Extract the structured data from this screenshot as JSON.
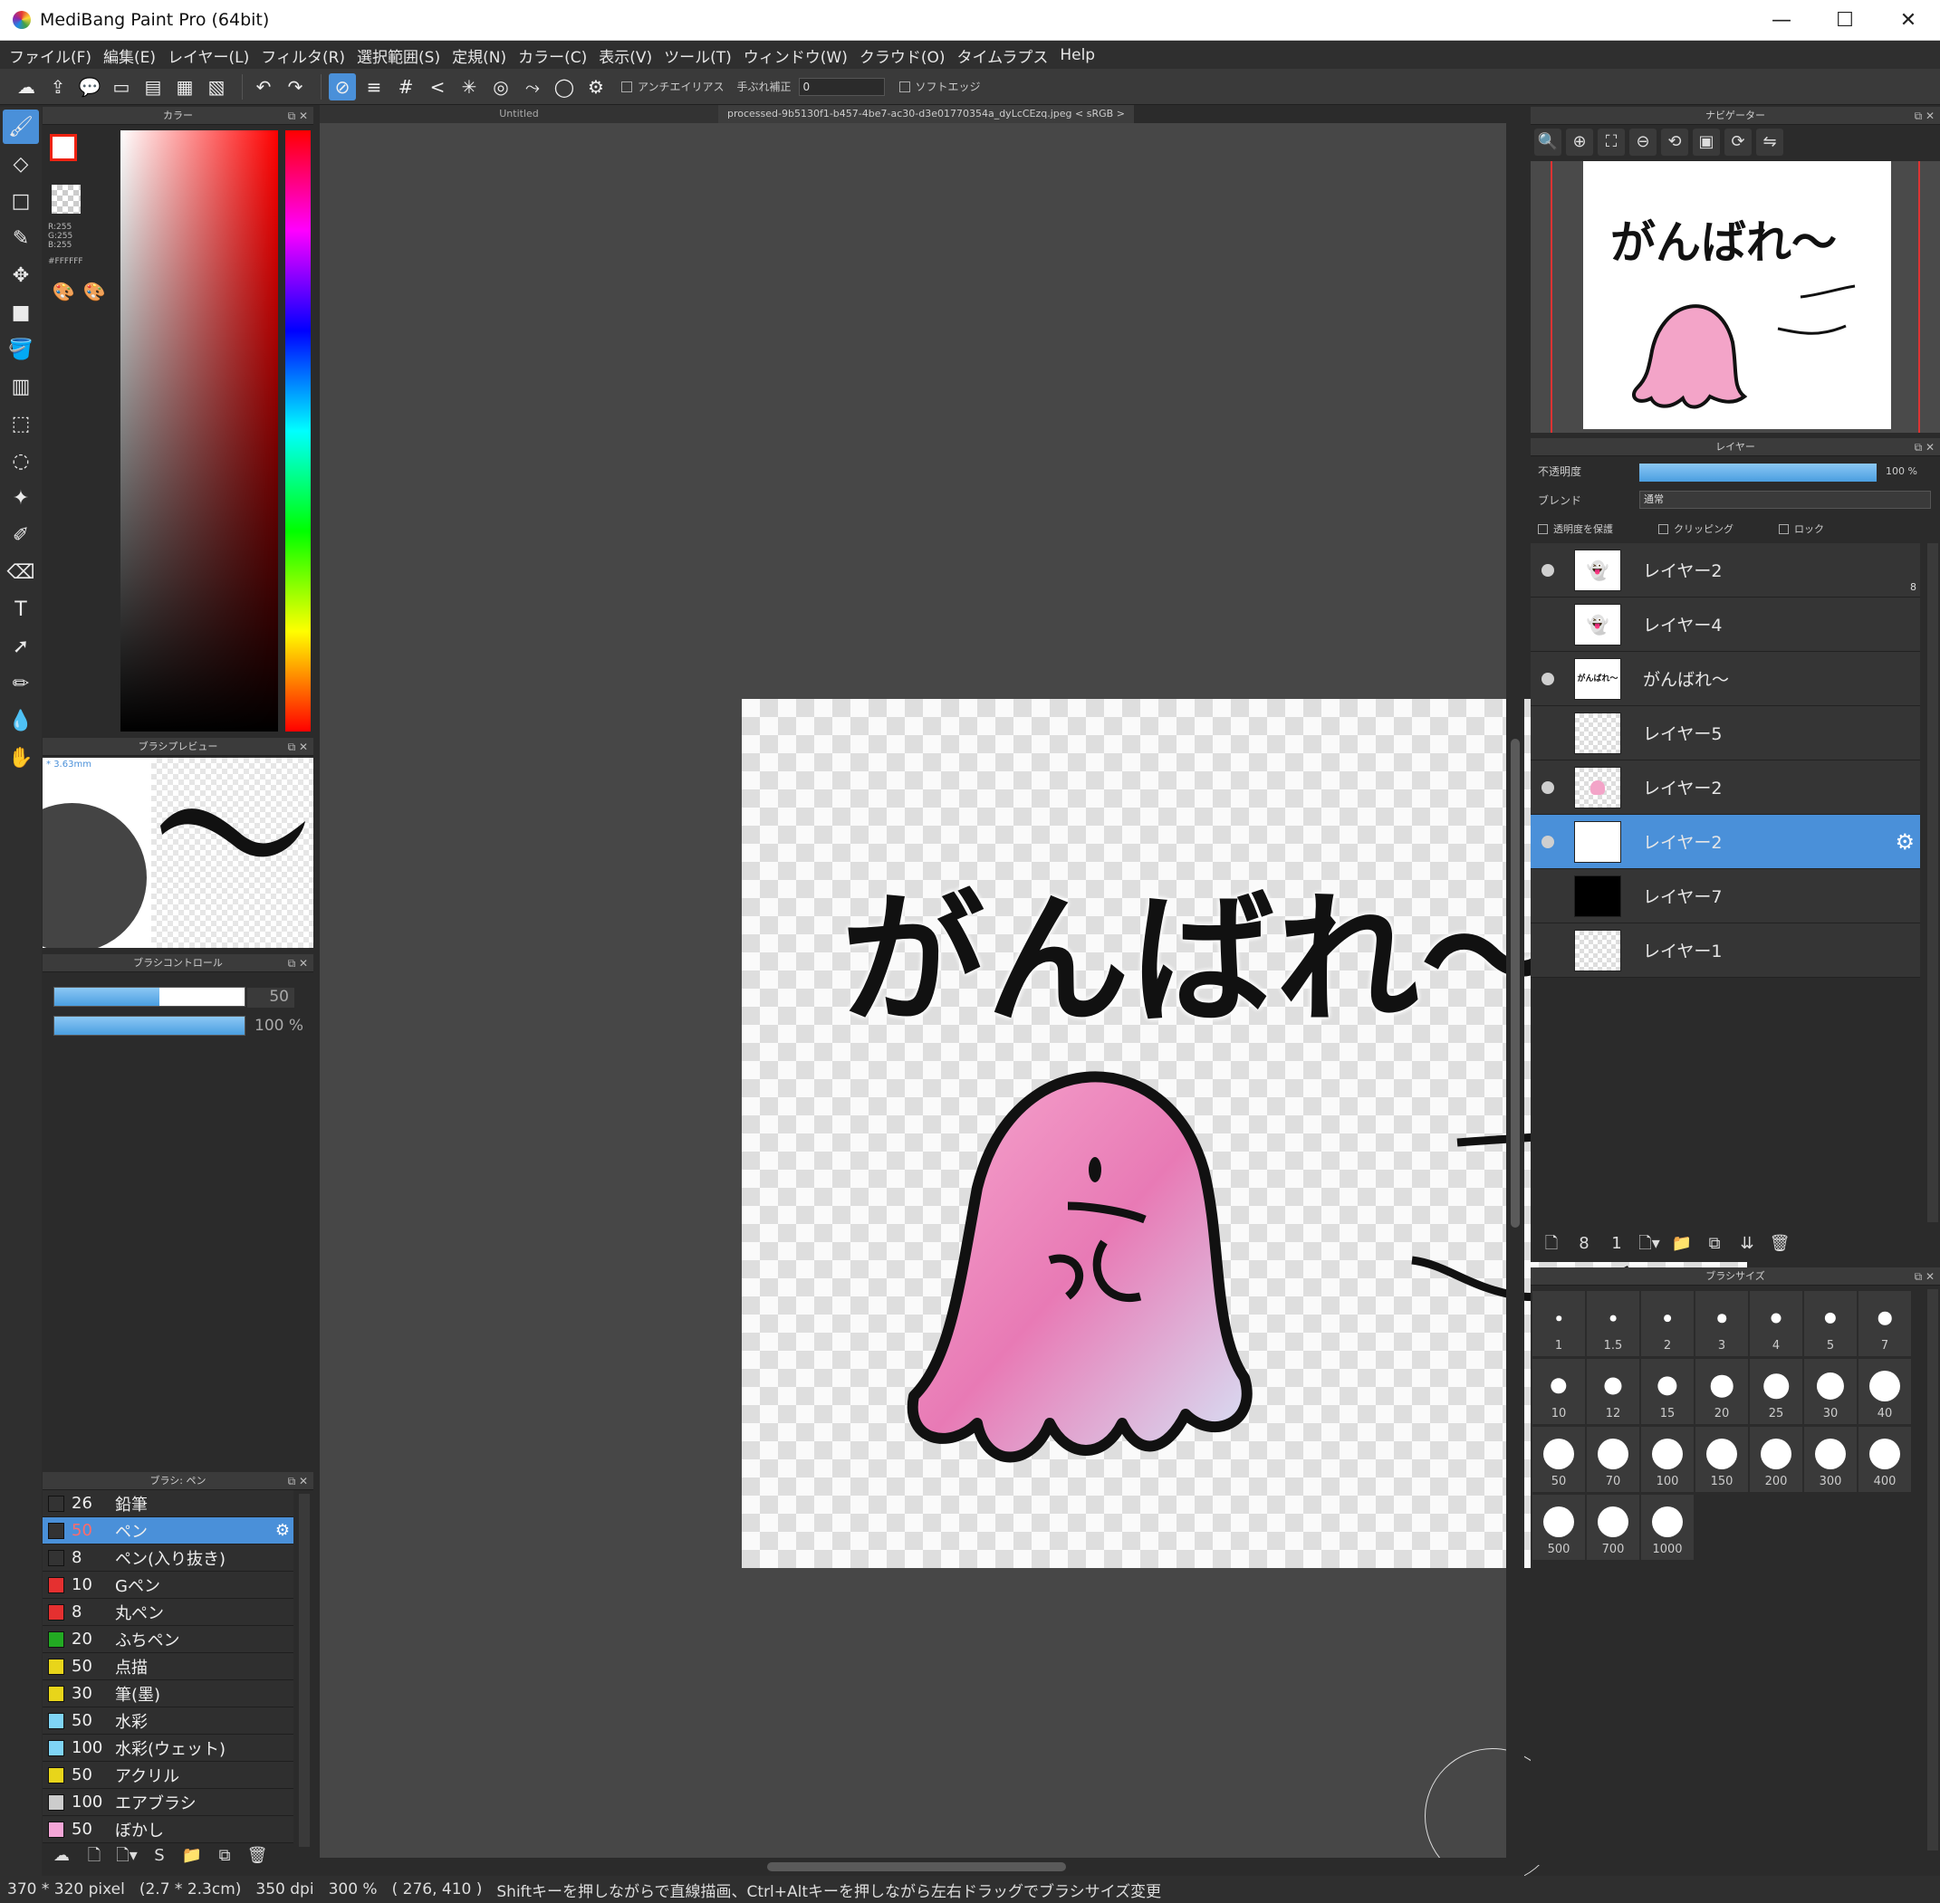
{
  "window": {
    "title": "MediBang Paint Pro (64bit)",
    "controls": {
      "minimize": "—",
      "maximize": "☐",
      "close": "✕"
    }
  },
  "menu": [
    "ファイル(F)",
    "編集(E)",
    "レイヤー(L)",
    "フィルタ(R)",
    "選択範囲(S)",
    "定規(N)",
    "カラー(C)",
    "表示(V)",
    "ツール(T)",
    "ウィンドウ(W)",
    "クラウド(O)",
    "タイムラプス",
    "Help"
  ],
  "toolbar": {
    "antialias_label": "アンチエイリアス",
    "stabilizer_label": "手ぶれ補正",
    "stabilizer_value": "0",
    "softedge_label": "ソフトエッジ"
  },
  "color_panel": {
    "title": "カラー",
    "rgb": "R:255\nG:255\nB:255",
    "hex": "#FFFFFF",
    "fg_color": "#FFFFFF",
    "bg_color": "#000000"
  },
  "brush_preview": {
    "title": "ブラシプレビュー",
    "size": "3.63mm"
  },
  "brush_control": {
    "title": "ブラシコントロール",
    "size_value": "50",
    "opacity_value": "100 %",
    "size_fraction": 0.55,
    "opacity_fraction": 1.0
  },
  "brush_list": {
    "title": "ブラシ: ペン",
    "items": [
      {
        "size": "26",
        "name": "鉛筆",
        "color": "#333333",
        "selected": false
      },
      {
        "size": "50",
        "name": "ペン",
        "color": "#333333",
        "selected": true
      },
      {
        "size": "8",
        "name": "ペン(入り抜き)",
        "color": "#333333",
        "selected": false
      },
      {
        "size": "10",
        "name": "Gペン",
        "color": "#e53030",
        "selected": false
      },
      {
        "size": "8",
        "name": "丸ペン",
        "color": "#e53030",
        "selected": false
      },
      {
        "size": "20",
        "name": "ふちペン",
        "color": "#22aa22",
        "selected": false
      },
      {
        "size": "50",
        "name": "点描",
        "color": "#e8d51a",
        "selected": false
      },
      {
        "size": "30",
        "name": "筆(墨)",
        "color": "#e8d51a",
        "selected": false
      },
      {
        "size": "50",
        "name": "水彩",
        "color": "#7fd4f5",
        "selected": false
      },
      {
        "size": "100",
        "name": "水彩(ウェット)",
        "color": "#7fd4f5",
        "selected": false
      },
      {
        "size": "50",
        "name": "アクリル",
        "color": "#e8d51a",
        "selected": false
      },
      {
        "size": "100",
        "name": "エアブラシ",
        "color": "#cccccc",
        "selected": false
      },
      {
        "size": "50",
        "name": "ぼかし",
        "color": "#f4a6d7",
        "selected": false
      }
    ]
  },
  "documents": {
    "tabs": [
      "Untitled",
      "processed-9b5130f1-b457-4be7-ac30-d3e01770354a_dyLcCEzq.jpeg < sRGB >"
    ],
    "canvas_text": "がんばれ〜"
  },
  "navigator": {
    "title": "ナビゲーター",
    "preview_text": "がんばれ〜"
  },
  "layers": {
    "title": "レイヤー",
    "opacity_label": "不透明度",
    "opacity_value": "100 %",
    "blend_label": "ブレンド",
    "blend_value": "通常",
    "protect_alpha": "透明度を保護",
    "clipping": "クリッピング",
    "lock": "ロック",
    "items": [
      {
        "name": "レイヤー2",
        "visible": true,
        "selected": false,
        "thumb": "ghost",
        "badge": "8"
      },
      {
        "name": "レイヤー4",
        "visible": false,
        "selected": false,
        "thumb": "ghost"
      },
      {
        "name": "がんばれ〜",
        "visible": true,
        "selected": false,
        "thumb": "text"
      },
      {
        "name": "レイヤー5",
        "visible": false,
        "selected": false,
        "thumb": "empty"
      },
      {
        "name": "レイヤー2",
        "visible": true,
        "selected": false,
        "thumb": "pink"
      },
      {
        "name": "レイヤー2",
        "visible": true,
        "selected": true,
        "thumb": "white"
      },
      {
        "name": "レイヤー7",
        "visible": false,
        "selected": false,
        "thumb": "black"
      },
      {
        "name": "レイヤー1",
        "visible": false,
        "selected": false,
        "thumb": "empty"
      }
    ]
  },
  "brush_size": {
    "title": "ブラシサイズ",
    "sizes": [
      "1",
      "1.5",
      "2",
      "3",
      "4",
      "5",
      "7",
      "10",
      "12",
      "15",
      "20",
      "25",
      "30",
      "40",
      "50",
      "70",
      "100",
      "150",
      "200",
      "300",
      "400",
      "500",
      "700",
      "1000"
    ]
  },
  "status": {
    "dimensions": "370 * 320 pixel",
    "physical": "(2.7 * 2.3cm)",
    "dpi": "350 dpi",
    "zoom": "300 %",
    "coords": "( 276, 410 )",
    "hint": "Shiftキーを押しながらで直線描画、Ctrl+Altキーを押しながら左右ドラッグでブラシサイズ変更"
  }
}
